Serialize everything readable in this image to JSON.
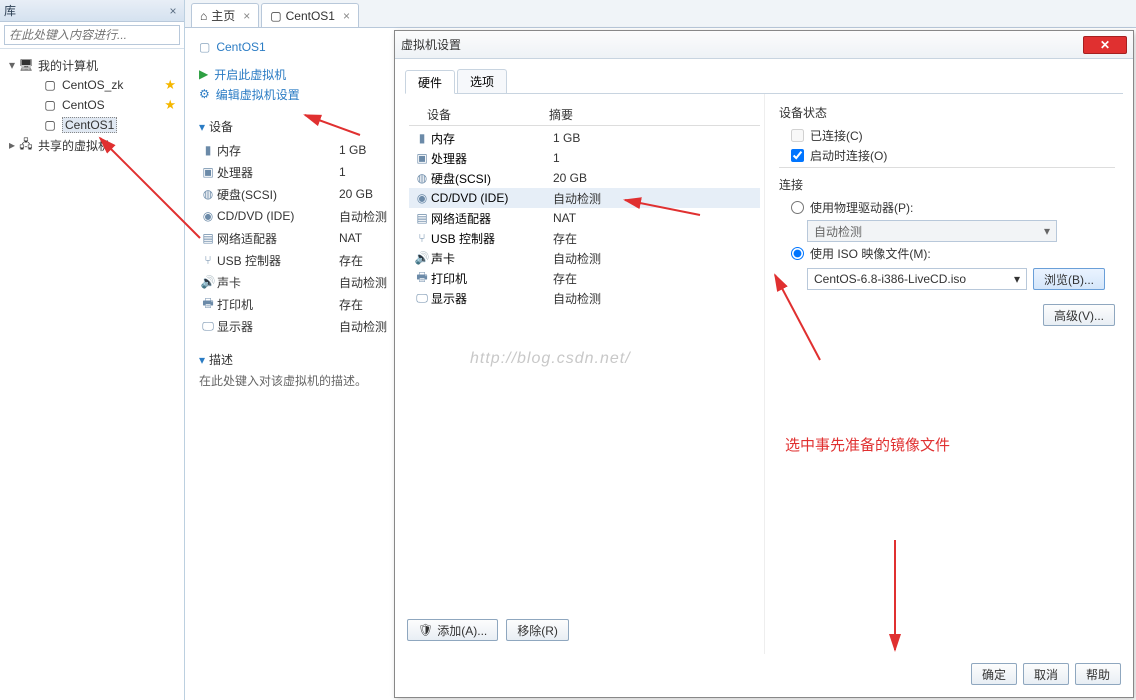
{
  "sidebar": {
    "title": "库",
    "search_placeholder": "在此处键入内容进行...",
    "root": "我的计算机",
    "items": [
      "CentOS_zk",
      "CentOS",
      "CentOS1"
    ],
    "shared": "共享的虚拟机"
  },
  "tabs": {
    "home": "主页",
    "vm": "CentOS1"
  },
  "vm": {
    "title": "CentOS1",
    "start": "开启此虚拟机",
    "edit": "编辑虚拟机设置",
    "devices_head": "设备",
    "devices": [
      {
        "n": "内存",
        "v": "1 GB"
      },
      {
        "n": "处理器",
        "v": "1"
      },
      {
        "n": "硬盘(SCSI)",
        "v": "20 GB"
      },
      {
        "n": "CD/DVD (IDE)",
        "v": "自动检测"
      },
      {
        "n": "网络适配器",
        "v": "NAT"
      },
      {
        "n": "USB 控制器",
        "v": "存在"
      },
      {
        "n": "声卡",
        "v": "自动检测"
      },
      {
        "n": "打印机",
        "v": "存在"
      },
      {
        "n": "显示器",
        "v": "自动检测"
      }
    ],
    "desc_head": "描述",
    "desc_hint": "在此处键入对该虚拟机的描述。"
  },
  "dialog": {
    "title": "虚拟机设置",
    "tab_hw": "硬件",
    "tab_opt": "选项",
    "col_dev": "设备",
    "col_sum": "摘要",
    "rows": [
      {
        "n": "内存",
        "v": "1 GB"
      },
      {
        "n": "处理器",
        "v": "1"
      },
      {
        "n": "硬盘(SCSI)",
        "v": "20 GB"
      },
      {
        "n": "CD/DVD (IDE)",
        "v": "自动检测"
      },
      {
        "n": "网络适配器",
        "v": "NAT"
      },
      {
        "n": "USB 控制器",
        "v": "存在"
      },
      {
        "n": "声卡",
        "v": "自动检测"
      },
      {
        "n": "打印机",
        "v": "存在"
      },
      {
        "n": "显示器",
        "v": "自动检测"
      }
    ],
    "status_head": "设备状态",
    "connected": "已连接(C)",
    "connect_on_start": "启动时连接(O)",
    "conn_head": "连接",
    "use_physical": "使用物理驱动器(P):",
    "auto_detect": "自动检测",
    "use_iso": "使用 ISO 映像文件(M):",
    "iso_value": "CentOS-6.8-i386-LiveCD.iso",
    "browse": "浏览(B)...",
    "advanced": "高级(V)...",
    "add": "添加(A)...",
    "remove": "移除(R)",
    "ok": "确定",
    "cancel": "取消",
    "help": "帮助",
    "annotation": "选中事先准备的镜像文件"
  },
  "watermark": "http://blog.csdn.net/"
}
